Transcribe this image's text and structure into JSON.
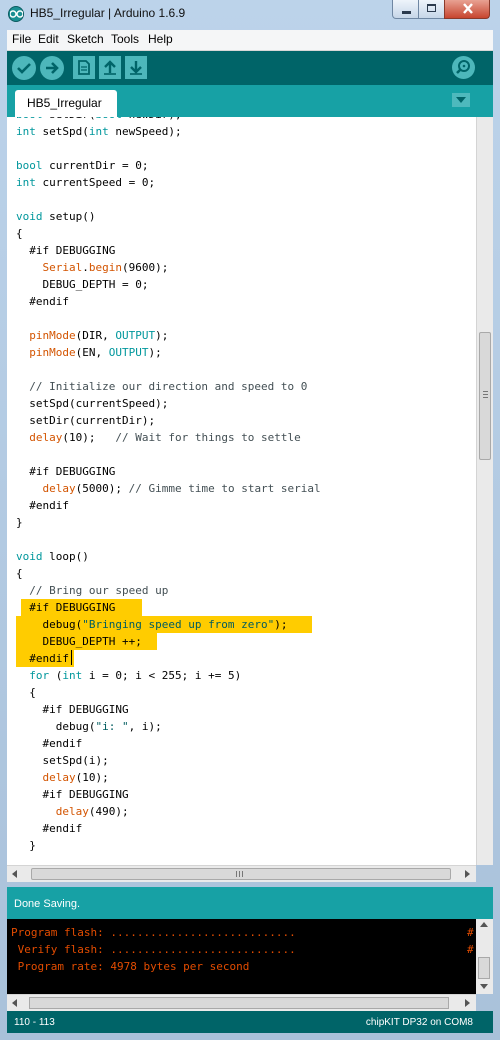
{
  "window": {
    "title": "HB5_Irregular | Arduino 1.6.9"
  },
  "menu": [
    "File",
    "Edit",
    "Sketch",
    "Tools",
    "Help"
  ],
  "toolbar": {
    "verify_icon": "check-icon",
    "upload_icon": "arrow-right-icon",
    "new_icon": "new-file-icon",
    "open_icon": "arrow-up-icon",
    "save_icon": "arrow-down-icon",
    "serial_icon": "magnifier-icon"
  },
  "tabs": [
    {
      "label": "HB5_Irregular"
    }
  ],
  "editor": {
    "lines": [
      "bool setDir(bool newDir);",
      "int setSpd(int newSpeed);",
      "",
      "bool currentDir = 0;",
      "int currentSpeed = 0;",
      "",
      "void setup()",
      "{",
      "  #if DEBUGGING",
      "    Serial.begin(9600);",
      "    DEBUG_DEPTH = 0;",
      "  #endif",
      "",
      "  pinMode(DIR, OUTPUT);",
      "  pinMode(EN, OUTPUT);",
      "",
      "  // Initialize our direction and speed to 0",
      "  setSpd(currentSpeed);",
      "  setDir(currentDir);",
      "  delay(10);   // Wait for things to settle",
      "",
      "  #if DEBUGGING",
      "    delay(5000); // Gimme time to start serial",
      "  #endif",
      "}",
      "",
      "void loop()",
      "{",
      "  // Bring our speed up",
      "  #if DEBUGGING",
      "    debug(\"Bringing speed up from zero\");",
      "    DEBUG_DEPTH ++;",
      "  #endif",
      "  for (int i = 0; i < 255; i += 5)",
      "  {",
      "    #if DEBUGGING",
      "      debug(\"i: \", i);",
      "    #endif",
      "    setSpd(i);",
      "    delay(10);",
      "    #if DEBUGGING",
      "      delay(490);",
      "    #endif",
      "  }"
    ]
  },
  "status": {
    "message": "Done Saving."
  },
  "console": {
    "lines": [
      "Program flash: ............................",
      " Verify flash: ............................",
      " Program rate: 4978 bytes per second"
    ],
    "trailing": [
      "#",
      "#"
    ]
  },
  "footer": {
    "line_range": "110 - 113",
    "board": "chipKIT DP32 on COM8"
  },
  "colors": {
    "teal_dark": "#006468",
    "teal_mid": "#17a1a5",
    "highlight": "#ffcc00",
    "console_text": "#e34c00"
  }
}
